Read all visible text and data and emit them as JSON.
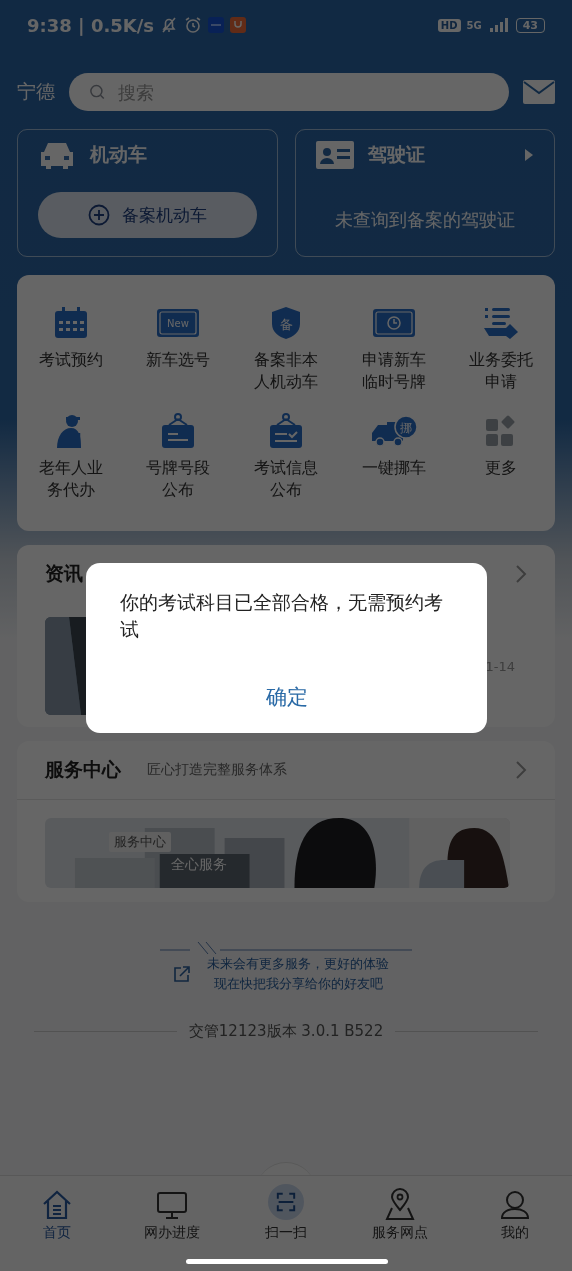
{
  "status_bar": {
    "time": "9:38 | 0.5K/s",
    "hd": "HD",
    "network": "5G",
    "battery": "43"
  },
  "header": {
    "city": "宁德",
    "search": {
      "placeholder": "搜索"
    }
  },
  "vehicle_card": {
    "title": "机动车",
    "button": "备案机动车"
  },
  "license_card": {
    "title": "驾驶证",
    "message": "未查询到备案的驾驶证"
  },
  "services": [
    {
      "label": "考试预约"
    },
    {
      "label": "新车选号",
      "badge": "New"
    },
    {
      "label": "备案非本人机动车",
      "badge": "备"
    },
    {
      "label": "申请新车临时号牌"
    },
    {
      "label": "业务委托申请"
    },
    {
      "label": "老年人业务代办"
    },
    {
      "label": "号牌号段公布"
    },
    {
      "label": "考试信息公布"
    },
    {
      "label": "一键挪车",
      "badge": "挪"
    },
    {
      "label": "更多"
    }
  ],
  "news": {
    "title": "资讯",
    "date": "1-14"
  },
  "service_center": {
    "title": "服务中心",
    "subtitle": "匠心打造完整服务体系",
    "banner_tag": "服务中心",
    "banner_text": "全心服务"
  },
  "share": {
    "lines": [
      "未来会有更多服务，更好的体验",
      "现在快把我分享给你的好友吧"
    ]
  },
  "version": "交管12123版本 3.0.1 B522",
  "tab_bar": [
    {
      "label": "首页",
      "selected": true
    },
    {
      "label": "网办进度",
      "selected": false
    },
    {
      "label": "扫一扫",
      "selected": false
    },
    {
      "label": "服务网点",
      "selected": false
    },
    {
      "label": "我的",
      "selected": false
    }
  ],
  "dialog": {
    "message": "你的考试科目已全部合格，无需预约考试",
    "button": "确定"
  }
}
